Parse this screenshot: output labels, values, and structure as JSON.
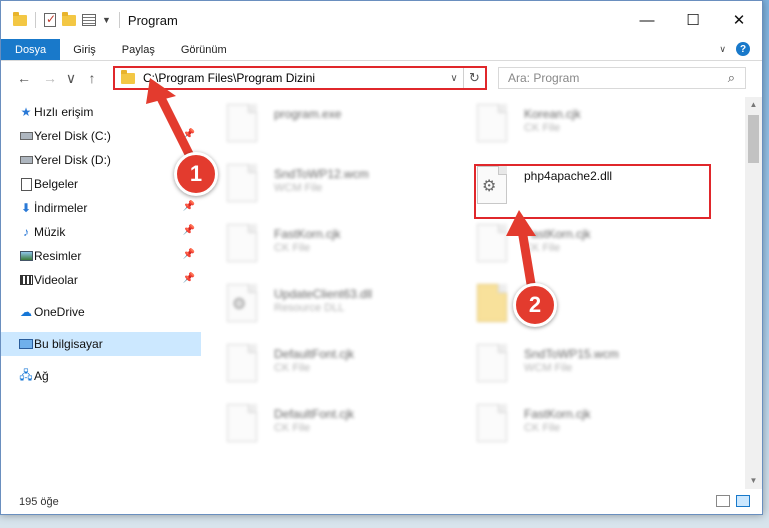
{
  "window": {
    "title": "Program"
  },
  "ribbon": {
    "tabs": [
      "Dosya",
      "Giriş",
      "Paylaş",
      "Görünüm"
    ]
  },
  "nav": {
    "back": "←",
    "forward": "→",
    "recent": "∨",
    "up": "↑",
    "address": "C:\\Program Files\\Program Dizini",
    "search_placeholder": "Ara: Program"
  },
  "sidebar": {
    "items": [
      {
        "label": "Hızlı erişim",
        "icon": "star-icon"
      },
      {
        "label": "Yerel Disk (C:)",
        "icon": "disk-icon",
        "pinned": true
      },
      {
        "label": "Yerel Disk (D:)",
        "icon": "disk-icon"
      },
      {
        "label": "Belgeler",
        "icon": "document-icon"
      },
      {
        "label": "İndirmeler",
        "icon": "download-icon",
        "pinned": true
      },
      {
        "label": "Müzik",
        "icon": "music-icon",
        "pinned": true
      },
      {
        "label": "Resimler",
        "icon": "picture-icon",
        "pinned": true
      },
      {
        "label": "Videolar",
        "icon": "video-icon",
        "pinned": true
      },
      {
        "label": "OneDrive",
        "icon": "cloud-icon"
      },
      {
        "label": "Bu bilgisayar",
        "icon": "computer-icon",
        "selected": true
      },
      {
        "label": "Ağ",
        "icon": "network-icon"
      }
    ]
  },
  "files": [
    {
      "name": "program.exe",
      "type": ""
    },
    {
      "name": "Korean.cjk",
      "type": "CK File"
    },
    {
      "name": "SndToWP12.wcm",
      "type": "WCM File"
    },
    {
      "name": "php4apache2.dll",
      "type": ""
    },
    {
      "name": "FastKorn.cjk",
      "type": "CK File"
    },
    {
      "name": "FastKorn.cjk",
      "type": "CK File"
    },
    {
      "name": "UpdateClient63.dll",
      "type": "Resource DLL"
    },
    {
      "name": "",
      "type": ""
    },
    {
      "name": "DefaultFont.cjk",
      "type": "CK File"
    },
    {
      "name": "SndToWP15.wcm",
      "type": "WCM File"
    },
    {
      "name": "DefaultFont.cjk",
      "type": "CK File"
    },
    {
      "name": "FastKorn.cjk",
      "type": "CK File"
    }
  ],
  "status": {
    "count": "195 öğe"
  },
  "annotations": {
    "step1": "1",
    "step2": "2"
  },
  "colors": {
    "accent": "#1979ca",
    "highlight": "#e0272b",
    "badge": "#e33b2e"
  }
}
